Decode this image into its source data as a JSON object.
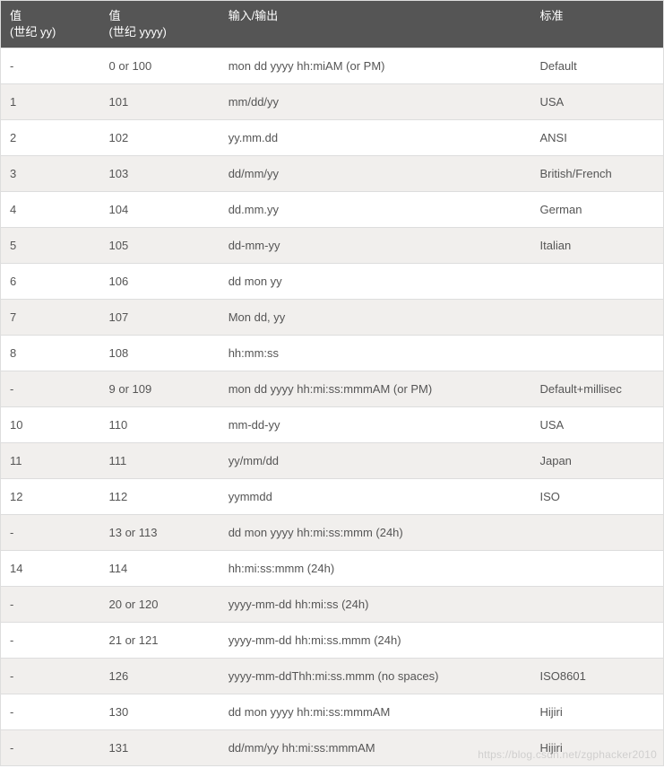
{
  "table": {
    "headers": {
      "col1_line1": "值",
      "col1_line2": "(世纪 yy)",
      "col2_line1": "值",
      "col2_line2": "(世纪 yyyy)",
      "col3": "输入/输出",
      "col4": "标准"
    },
    "rows": [
      {
        "c1": "-",
        "c2": "0 or 100",
        "c3": "mon dd yyyy hh:miAM (or PM)",
        "c4": "Default"
      },
      {
        "c1": "1",
        "c2": "101",
        "c3": "mm/dd/yy",
        "c4": "USA"
      },
      {
        "c1": "2",
        "c2": "102",
        "c3": "yy.mm.dd",
        "c4": "ANSI"
      },
      {
        "c1": "3",
        "c2": "103",
        "c3": "dd/mm/yy",
        "c4": "British/French"
      },
      {
        "c1": "4",
        "c2": "104",
        "c3": "dd.mm.yy",
        "c4": "German"
      },
      {
        "c1": "5",
        "c2": "105",
        "c3": "dd-mm-yy",
        "c4": "Italian"
      },
      {
        "c1": "6",
        "c2": "106",
        "c3": "dd mon yy",
        "c4": ""
      },
      {
        "c1": "7",
        "c2": "107",
        "c3": "Mon dd, yy",
        "c4": ""
      },
      {
        "c1": "8",
        "c2": "108",
        "c3": "hh:mm:ss",
        "c4": ""
      },
      {
        "c1": "-",
        "c2": "9 or 109",
        "c3": "mon dd yyyy hh:mi:ss:mmmAM (or PM)",
        "c4": "Default+millisec"
      },
      {
        "c1": "10",
        "c2": "110",
        "c3": "mm-dd-yy",
        "c4": "USA"
      },
      {
        "c1": "11",
        "c2": "111",
        "c3": "yy/mm/dd",
        "c4": "Japan"
      },
      {
        "c1": "12",
        "c2": "112",
        "c3": "yymmdd",
        "c4": "ISO"
      },
      {
        "c1": "-",
        "c2": "13 or 113",
        "c3": "dd mon yyyy hh:mi:ss:mmm (24h)",
        "c4": ""
      },
      {
        "c1": "14",
        "c2": "114",
        "c3": "hh:mi:ss:mmm (24h)",
        "c4": ""
      },
      {
        "c1": "-",
        "c2": "20 or 120",
        "c3": "yyyy-mm-dd hh:mi:ss (24h)",
        "c4": ""
      },
      {
        "c1": "-",
        "c2": "21 or 121",
        "c3": "yyyy-mm-dd hh:mi:ss.mmm (24h)",
        "c4": ""
      },
      {
        "c1": "-",
        "c2": "126",
        "c3": "yyyy-mm-ddThh:mi:ss.mmm (no spaces)",
        "c4": "ISO8601"
      },
      {
        "c1": "-",
        "c2": "130",
        "c3": "dd mon yyyy hh:mi:ss:mmmAM",
        "c4": "Hijiri"
      },
      {
        "c1": "-",
        "c2": "131",
        "c3": "dd/mm/yy hh:mi:ss:mmmAM",
        "c4": "Hijiri"
      }
    ]
  },
  "watermark": "https://blog.csdn.net/zgphacker2010"
}
